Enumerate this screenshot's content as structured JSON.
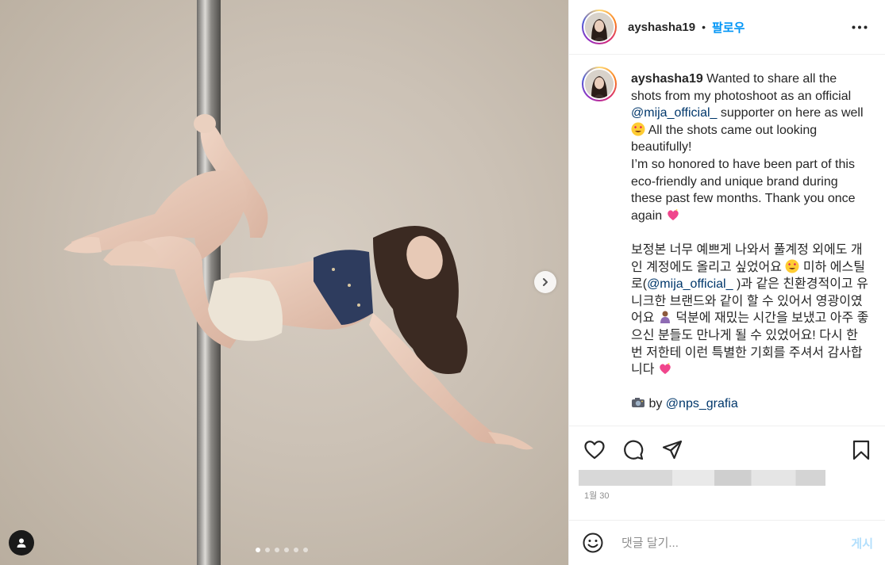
{
  "post": {
    "username": "ayshasha19",
    "separator": "•",
    "follow_label": "팔로우",
    "more_icon": "more-options-icon",
    "caption": {
      "username": "ayshasha19",
      "seg1": " Wanted to share all the shots from my photoshoot as an official ",
      "mention1": "@mija_official_",
      "seg2": " supporter on here as well ",
      "seg3": " All the shots came out looking beautifully!\nI’m so honored to have been part of this eco-friendly and unique brand during these past few months. Thank you once again ",
      "seg4": "\n\n보정본 너무 예쁘게 나와서 풀계정 외에도 개인 계정에도 올리고 싶었어요 ",
      "seg5": " 미하 에스틸로(",
      "mention2": "@mija_official_",
      "seg6": " )과 같은 친환경적이고 유니크한 브랜드와 같이 할 수 있어서 영광이였어요 ",
      "seg7": " 덕분에 재밌는 시간을 보냈고 아주 좋으신 분들도 만나게 될 수 있었어요! 다시 한번 저한테 이런 특별한 기회를 주셔서 감사합니다 ",
      "seg8": "\n\n",
      "seg9": " by ",
      "mention3": "@nps_grafia"
    },
    "date": "1월 30",
    "photo_dots": 6,
    "photo_active_index": 0
  },
  "actions": {
    "like_icon": "heart-icon",
    "comment_icon": "comment-icon",
    "share_icon": "share-icon",
    "save_icon": "bookmark-icon"
  },
  "comment": {
    "placeholder": "댓글 달기...",
    "post_label": "게시",
    "emoji_icon": "emoji-icon"
  },
  "colors": {
    "link": "#0095f6",
    "mention": "#00376b",
    "post_disabled": "#b2dffc",
    "photo_background": "#cbc1b5"
  }
}
